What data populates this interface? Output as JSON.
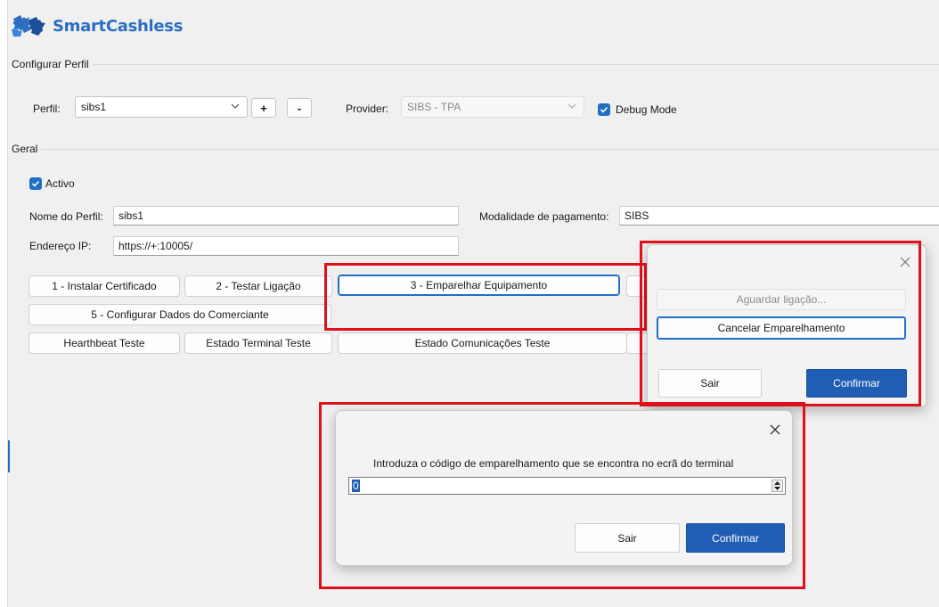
{
  "app": {
    "title": "SmartCashless"
  },
  "perfil_group": {
    "title": "Configurar Perfil",
    "perfil_label": "Perfil:",
    "perfil_value": "sibs1",
    "add_label": "+",
    "remove_label": "-",
    "provider_label": "Provider:",
    "provider_value": "SIBS - TPA",
    "debug_label": "Debug Mode"
  },
  "geral_group": {
    "title": "Geral",
    "activo_label": "Activo",
    "nome_label": "Nome do Perfil:",
    "nome_value": "sibs1",
    "ip_label": "Endereço IP:",
    "ip_value": "https://+:10005/",
    "modalidade_label": "Modalidade de pagamento:",
    "modalidade_value": "SIBS",
    "buttons": {
      "instalar": "1 - Instalar Certificado",
      "testar": "2 - Testar Ligação",
      "emparelhar": "3 - Emparelhar Equipamento",
      "configurar": "5 - Configurar Dados do Comerciante",
      "heartbeat": "Hearthbeat Teste",
      "estado_terminal": "Estado Terminal Teste",
      "estado_com": "Estado Comunicações Teste"
    }
  },
  "pairing_dialog": {
    "waiting_label": "Aguardar ligação...",
    "cancel_label": "Cancelar Emparelhamento",
    "sair_label": "Sair",
    "confirm_label": "Confirmar"
  },
  "code_dialog": {
    "prompt": "Introduza o código de emparelhamento que se encontra no ecrã do terminal",
    "code_value": "0",
    "sair_label": "Sair",
    "confirm_label": "Confirmar"
  },
  "colors": {
    "accent": "#1f6fc5",
    "primary_button": "#1f5eb4",
    "highlight": "#e0101a",
    "title": "#2d6ec4"
  }
}
